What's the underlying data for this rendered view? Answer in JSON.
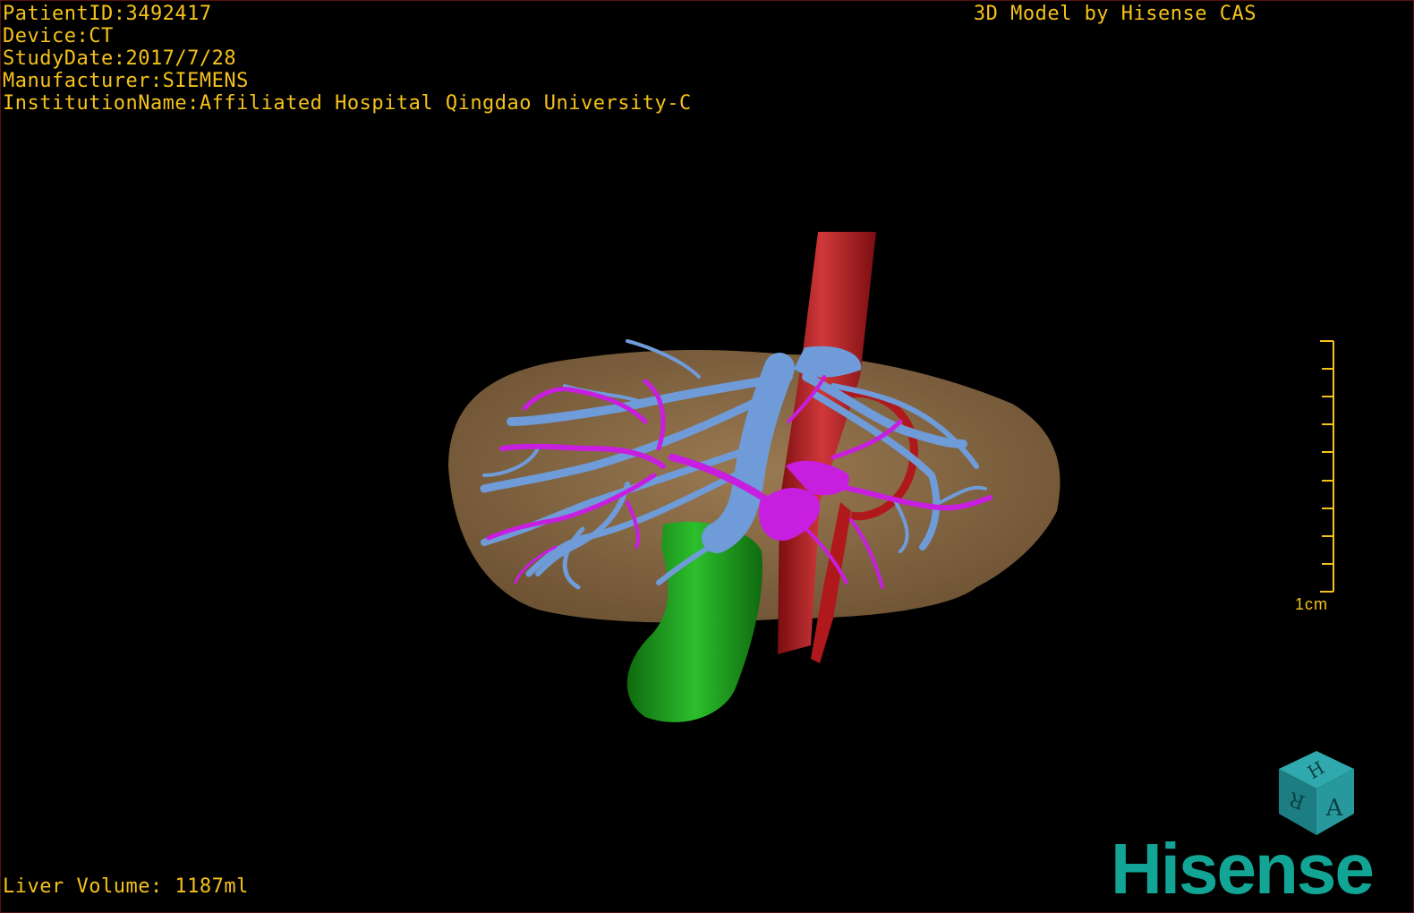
{
  "patient_info": {
    "patient_id": "PatientID:3492417",
    "device": "Device:CT",
    "study_date": "StudyDate:2017/7/28",
    "manufacturer": "Manufacturer:SIEMENS",
    "institution": "InstitutionName:Affiliated Hospital Qingdao University-C"
  },
  "model_credit": "3D Model by Hisense CAS",
  "liver_volume": "Liver Volume: 1187ml",
  "scale_bar": {
    "label": "1cm"
  },
  "orientation_cube": {
    "top_face": "H",
    "left_face": "R",
    "right_face": "A"
  },
  "brand": {
    "name": "Hisense",
    "color": "#12a596"
  },
  "colors": {
    "overlay_text": "#f5c21b",
    "liver": "#8a6a45",
    "portal_vein": "#6f9bd9",
    "hepatic_artery": "#c81ee0",
    "aorta": "#b0191c",
    "gallbladder": "#1a8f1a"
  }
}
